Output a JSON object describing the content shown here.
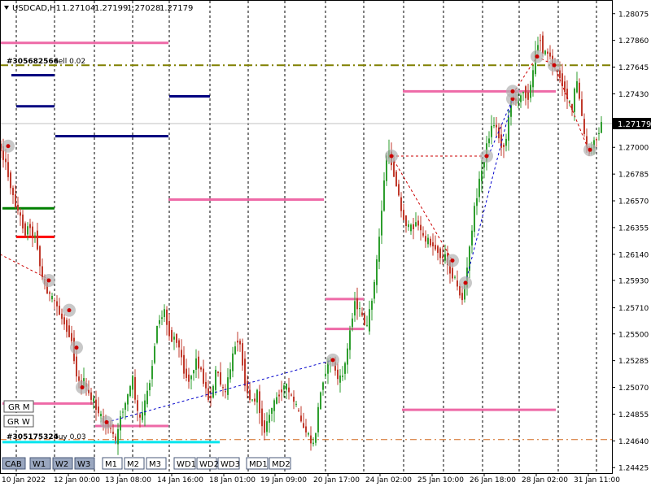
{
  "chart_header": {
    "symbol": "USDCAD,H1",
    "open": "1.27104",
    "high": "1.27199",
    "low": "1.27028",
    "close": "1.27179"
  },
  "colors": {
    "background": "#ffffff",
    "bull_candle": "#2e9e2e",
    "bear_candle": "#c0392b",
    "grid": "#000000",
    "pink_level": "#ee6aa7",
    "navy_level": "#000080",
    "green_level": "#008000",
    "red_level": "#ff0000",
    "cyan_level": "#00e5ee",
    "olive_dash": "#808000",
    "price_tag_bg": "#000000",
    "zigzag_blue": "#0000cc",
    "zigzag_red": "#cc0000",
    "marker_gray": "#b0b0b0"
  },
  "price_axis": {
    "ticks": [
      "1.28075",
      "1.27860",
      "1.27645",
      "1.27430",
      "1.27215",
      "1.27000",
      "1.26785",
      "1.26570",
      "1.26355",
      "1.26140",
      "1.25930",
      "1.25710",
      "1.25500",
      "1.25285",
      "1.25070",
      "1.24855",
      "1.24640",
      "1.24425"
    ],
    "current_price": "1.27179"
  },
  "time_axis": {
    "labels": [
      "10 Jan 2022",
      "12 Jan 00:00",
      "13 Jan 08:00",
      "14 Jan 16:00",
      "18 Jan 01:00",
      "19 Jan 09:00",
      "20 Jan 17:00",
      "24 Jan 02:00",
      "25 Jan 10:00",
      "26 Jan 18:00",
      "28 Jan 02:00",
      "31 Jan 11:00"
    ]
  },
  "orders": {
    "sell": {
      "ticket": "#305682566",
      "label": "sell 0.02",
      "price": 1.2766
    },
    "buy": {
      "ticket": "#305175324",
      "label": "buy 0.03",
      "price": 1.2465
    }
  },
  "side_buttons": [
    "GR M",
    "GR W"
  ],
  "bottom_buttons": [
    "CAB",
    "W1",
    "W2",
    "W3",
    "M1",
    "M2",
    "M3",
    "WD1",
    "WD2",
    "WD3",
    "MD1",
    "MD2"
  ],
  "chart_data": {
    "type": "candlestick",
    "symbol": "USDCAD",
    "timeframe": "H1",
    "ylim": [
      1.2442,
      1.2808
    ],
    "price_path": [
      [
        0,
        1.2702
      ],
      [
        5,
        1.2695
      ],
      [
        10,
        1.2684
      ],
      [
        14,
        1.2672
      ],
      [
        18,
        1.266
      ],
      [
        22,
        1.2652
      ],
      [
        26,
        1.2646
      ],
      [
        30,
        1.2637
      ],
      [
        34,
        1.2629
      ],
      [
        38,
        1.2642
      ],
      [
        42,
        1.2626
      ],
      [
        45,
        1.2631
      ],
      [
        48,
        1.262
      ],
      [
        52,
        1.26
      ],
      [
        56,
        1.259
      ],
      [
        60,
        1.2585
      ],
      [
        65,
        1.2578
      ],
      [
        70,
        1.2576
      ],
      [
        75,
        1.2566
      ],
      [
        80,
        1.256
      ],
      [
        85,
        1.2553
      ],
      [
        90,
        1.2545
      ],
      [
        95,
        1.252
      ],
      [
        100,
        1.2508
      ],
      [
        105,
        1.2512
      ],
      [
        110,
        1.2502
      ],
      [
        115,
        1.2498
      ],
      [
        120,
        1.2491
      ],
      [
        125,
        1.2484
      ],
      [
        130,
        1.2478
      ],
      [
        135,
        1.2476
      ],
      [
        140,
        1.247
      ],
      [
        145,
        1.2462
      ],
      [
        150,
        1.2485
      ],
      [
        155,
        1.2492
      ],
      [
        160,
        1.2503
      ],
      [
        165,
        1.2514
      ],
      [
        170,
        1.2488
      ],
      [
        175,
        1.248
      ],
      [
        180,
        1.2495
      ],
      [
        185,
        1.2508
      ],
      [
        190,
        1.253
      ],
      [
        195,
        1.2558
      ],
      [
        200,
        1.2563
      ],
      [
        204,
        1.2569
      ],
      [
        208,
        1.2554
      ],
      [
        213,
        1.2546
      ],
      [
        218,
        1.2548
      ],
      [
        223,
        1.2536
      ],
      [
        228,
        1.2521
      ],
      [
        233,
        1.2512
      ],
      [
        238,
        1.2518
      ],
      [
        243,
        1.2529
      ],
      [
        248,
        1.2522
      ],
      [
        253,
        1.251
      ],
      [
        258,
        1.2498
      ],
      [
        263,
        1.2502
      ],
      [
        268,
        1.2524
      ],
      [
        273,
        1.251
      ],
      [
        278,
        1.25
      ],
      [
        283,
        1.2516
      ],
      [
        288,
        1.2532
      ],
      [
        293,
        1.2548
      ],
      [
        298,
        1.2538
      ],
      [
        303,
        1.2511
      ],
      [
        308,
        1.2499
      ],
      [
        313,
        1.2495
      ],
      [
        318,
        1.2502
      ],
      [
        323,
        1.2479
      ],
      [
        328,
        1.2472
      ],
      [
        333,
        1.2486
      ],
      [
        338,
        1.2493
      ],
      [
        343,
        1.25
      ],
      [
        348,
        1.2506
      ],
      [
        353,
        1.2509
      ],
      [
        358,
        1.2501
      ],
      [
        363,
        1.2496
      ],
      [
        368,
        1.2488
      ],
      [
        373,
        1.2476
      ],
      [
        378,
        1.2472
      ],
      [
        383,
        1.2464
      ],
      [
        388,
        1.246
      ],
      [
        393,
        1.249
      ],
      [
        398,
        1.2511
      ],
      [
        403,
        1.2523
      ],
      [
        408,
        1.253
      ],
      [
        413,
        1.2524
      ],
      [
        418,
        1.2511
      ],
      [
        423,
        1.2518
      ],
      [
        428,
        1.2532
      ],
      [
        433,
        1.2558
      ],
      [
        438,
        1.2576
      ],
      [
        443,
        1.257
      ],
      [
        448,
        1.2562
      ],
      [
        453,
        1.2555
      ],
      [
        458,
        1.2575
      ],
      [
        463,
        1.2595
      ],
      [
        468,
        1.2628
      ],
      [
        473,
        1.2665
      ],
      [
        477,
        1.2694
      ],
      [
        481,
        1.2695
      ],
      [
        485,
        1.268
      ],
      [
        490,
        1.2669
      ],
      [
        495,
        1.2648
      ],
      [
        500,
        1.264
      ],
      [
        505,
        1.2634
      ],
      [
        510,
        1.2637
      ],
      [
        515,
        1.2641
      ],
      [
        520,
        1.263
      ],
      [
        525,
        1.2625
      ],
      [
        530,
        1.2624
      ],
      [
        535,
        1.262
      ],
      [
        540,
        1.2617
      ],
      [
        545,
        1.261
      ],
      [
        550,
        1.2613
      ],
      [
        555,
        1.26
      ],
      [
        560,
        1.2596
      ],
      [
        565,
        1.2585
      ],
      [
        570,
        1.2578
      ],
      [
        575,
        1.2596
      ],
      [
        580,
        1.2625
      ],
      [
        585,
        1.265
      ],
      [
        590,
        1.267
      ],
      [
        595,
        1.2684
      ],
      [
        600,
        1.2701
      ],
      [
        605,
        1.2715
      ],
      [
        610,
        1.272
      ],
      [
        615,
        1.2708
      ],
      [
        620,
        1.2698
      ],
      [
        625,
        1.271
      ],
      [
        630,
        1.274
      ],
      [
        635,
        1.2738
      ],
      [
        640,
        1.2737
      ],
      [
        645,
        1.2747
      ],
      [
        650,
        1.2738
      ],
      [
        655,
        1.2752
      ],
      [
        660,
        1.2775
      ],
      [
        665,
        1.2791
      ],
      [
        670,
        1.2774
      ],
      [
        675,
        1.2777
      ],
      [
        680,
        1.2769
      ],
      [
        685,
        1.2763
      ],
      [
        690,
        1.2757
      ],
      [
        695,
        1.2748
      ],
      [
        700,
        1.2738
      ],
      [
        705,
        1.273
      ],
      [
        710,
        1.2756
      ],
      [
        715,
        1.2735
      ],
      [
        720,
        1.2709
      ],
      [
        725,
        1.2695
      ],
      [
        730,
        1.2702
      ],
      [
        735,
        1.2708
      ],
      [
        740,
        1.2718
      ]
    ],
    "levels": {
      "pink": [
        {
          "price": 1.2784,
          "from": 0,
          "to": 207
        },
        {
          "price": 1.2658,
          "from": 207,
          "to": 398
        },
        {
          "price": 1.2578,
          "from": 400,
          "to": 447
        },
        {
          "price": 1.2554,
          "from": 400,
          "to": 447
        },
        {
          "price": 1.2745,
          "from": 495,
          "to": 683
        },
        {
          "price": 1.2489,
          "from": 494,
          "to": 683
        },
        {
          "price": 1.2494,
          "from": 3,
          "to": 115
        },
        {
          "price": 1.2476,
          "from": 117,
          "to": 207
        }
      ],
      "navy": [
        {
          "price": 1.2758,
          "from": 14,
          "to": 67
        },
        {
          "price": 1.2733,
          "from": 20,
          "to": 67
        },
        {
          "price": 1.2709,
          "from": 68,
          "to": 207
        },
        {
          "price": 1.2741,
          "from": 208,
          "to": 258
        }
      ],
      "green": [
        {
          "price": 1.2651,
          "from": 3,
          "to": 67
        }
      ],
      "red": [
        {
          "price": 1.2628,
          "from": 20,
          "to": 67
        }
      ],
      "cyan": [
        {
          "price": 1.2463,
          "from": 3,
          "to": 270
        }
      ]
    },
    "zigzag": [
      {
        "color": "blue",
        "points": [
          [
            131,
            1.2479
          ],
          [
            409,
            1.2529
          ]
        ]
      },
      {
        "color": "red",
        "points": [
          [
            0,
            1.2614
          ],
          [
            60,
            1.2594
          ]
        ]
      },
      {
        "color": "red",
        "points": [
          [
            481,
            1.2693
          ],
          [
            600,
            1.2693
          ]
        ]
      },
      {
        "color": "red",
        "points": [
          [
            481,
            1.2693
          ],
          [
            556,
            1.2609
          ]
        ]
      },
      {
        "color": "blue",
        "points": [
          [
            572,
            1.2591
          ],
          [
            630,
            1.2739
          ]
        ]
      },
      {
        "color": "blue",
        "points": [
          [
            600,
            1.2693
          ],
          [
            630,
            1.2739
          ]
        ]
      },
      {
        "color": "red",
        "points": [
          [
            630,
            1.2743
          ],
          [
            660,
            1.2773
          ]
        ]
      },
      {
        "color": "red",
        "points": [
          [
            660,
            1.2773
          ],
          [
            681,
            1.2766
          ]
        ]
      },
      {
        "color": "red",
        "points": [
          [
            681,
            1.2766
          ],
          [
            725,
            1.2695
          ]
        ]
      }
    ],
    "markers": [
      [
        10,
        1.2701
      ],
      [
        60,
        1.2593
      ],
      [
        85,
        1.2569
      ],
      [
        94,
        1.2539
      ],
      [
        101,
        1.2507
      ],
      [
        131,
        1.2479
      ],
      [
        409,
        1.2529
      ],
      [
        481,
        1.2693
      ],
      [
        556,
        1.2609
      ],
      [
        572,
        1.2591
      ],
      [
        598,
        1.2693
      ],
      [
        630,
        1.2739
      ],
      [
        630,
        1.2745
      ],
      [
        660,
        1.2773
      ],
      [
        681,
        1.2766
      ],
      [
        725,
        1.2698
      ]
    ]
  }
}
